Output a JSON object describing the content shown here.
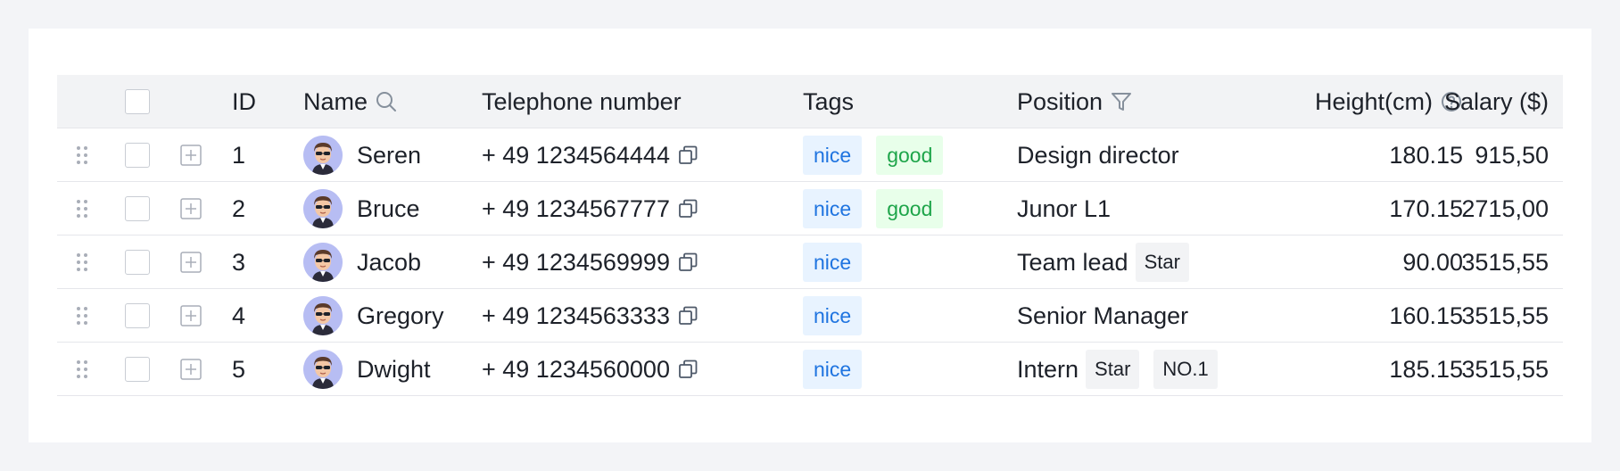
{
  "table": {
    "headers": {
      "id": "ID",
      "name": "Name",
      "telephone": "Telephone number",
      "tags": "Tags",
      "position": "Position",
      "height": "Height(cm)",
      "salary": "Salary ($)"
    },
    "rows": [
      {
        "id": "1",
        "name": "Seren",
        "telephone": "+ 49 1234564444",
        "tags": [
          "nice",
          "good"
        ],
        "position": "Design director",
        "position_tags": [],
        "height": "180.15",
        "salary": "915,50"
      },
      {
        "id": "2",
        "name": "Bruce",
        "telephone": "+ 49 1234567777",
        "tags": [
          "nice",
          "good"
        ],
        "position": "Junor L1",
        "position_tags": [],
        "height": "170.15",
        "salary": "2715,00"
      },
      {
        "id": "3",
        "name": "Jacob",
        "telephone": "+ 49 1234569999",
        "tags": [
          "nice"
        ],
        "position": "Team lead",
        "position_tags": [
          "Star"
        ],
        "height": "90.00",
        "salary": "3515,55"
      },
      {
        "id": "4",
        "name": "Gregory",
        "telephone": "+ 49 1234563333",
        "tags": [
          "nice"
        ],
        "position": "Senior Manager",
        "position_tags": [],
        "height": "160.15",
        "salary": "3515,55"
      },
      {
        "id": "5",
        "name": "Dwight",
        "telephone": "+ 49 1234560000",
        "tags": [
          "nice"
        ],
        "position": "Intern",
        "position_tags": [
          "Star",
          "NO.1"
        ],
        "height": "185.15",
        "salary": "3515,55"
      }
    ]
  },
  "icons": {
    "name_header": "search-icon",
    "position_header": "filter-icon",
    "height_header": "help-circle-icon",
    "telephone": "copy-icon",
    "row_handle": "drag-handle-icon",
    "row_expand": "expand-plus-icon"
  },
  "colors": {
    "nice_tag_bg": "#e8f3ff",
    "nice_tag_text": "#1f74e0",
    "good_tag_bg": "#e8ffea",
    "good_tag_text": "#1ea54a",
    "header_bg": "#f2f3f5",
    "avatar_bg": "#b7bdf3"
  }
}
